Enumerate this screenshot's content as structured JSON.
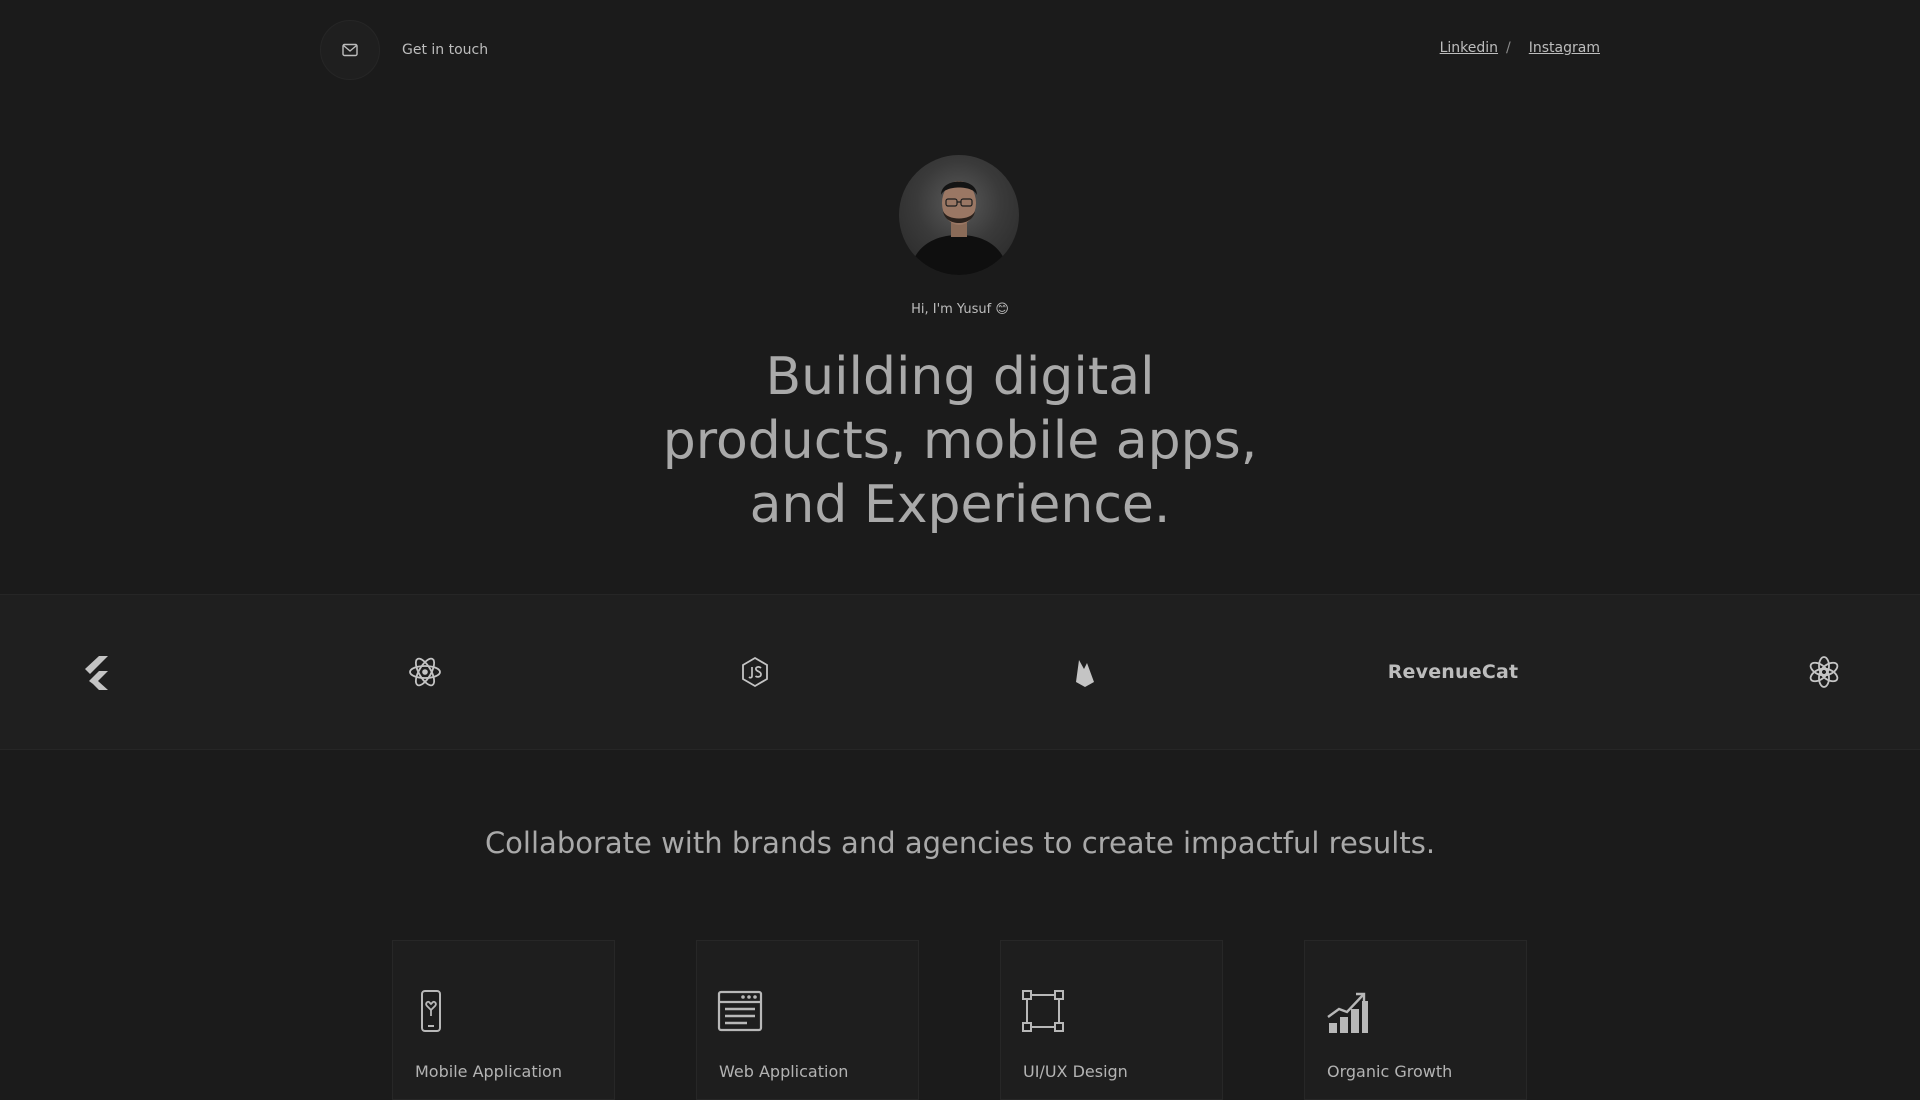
{
  "header": {
    "contact_label": "Get in touch",
    "social": [
      {
        "label": "Linkedin"
      },
      {
        "label": "Instagram"
      }
    ],
    "separator": "/"
  },
  "hero": {
    "greeting": "Hi, I'm Yusuf 😊",
    "title_lines": [
      "Building digital",
      "products, mobile apps,",
      "and Experience."
    ]
  },
  "tech": [
    {
      "icon": "flutter-icon"
    },
    {
      "icon": "react-icon"
    },
    {
      "icon": "nodejs-icon"
    },
    {
      "icon": "firebase-icon"
    },
    {
      "text": "RevenueCat"
    },
    {
      "icon": "openai-icon"
    }
  ],
  "collab": "Collaborate with brands and agencies to create impactful results.",
  "services": [
    {
      "label": "Mobile Application",
      "icon": "mobile-icon"
    },
    {
      "label": "Web Application",
      "icon": "browser-icon"
    },
    {
      "label": "UI/UX Design",
      "icon": "frame-icon"
    },
    {
      "label": "Organic Growth",
      "icon": "growth-chart-icon"
    }
  ],
  "colors": {
    "background": "#1b1b1b",
    "strip": "#1f1f1f",
    "text": "#a9a9a9"
  }
}
